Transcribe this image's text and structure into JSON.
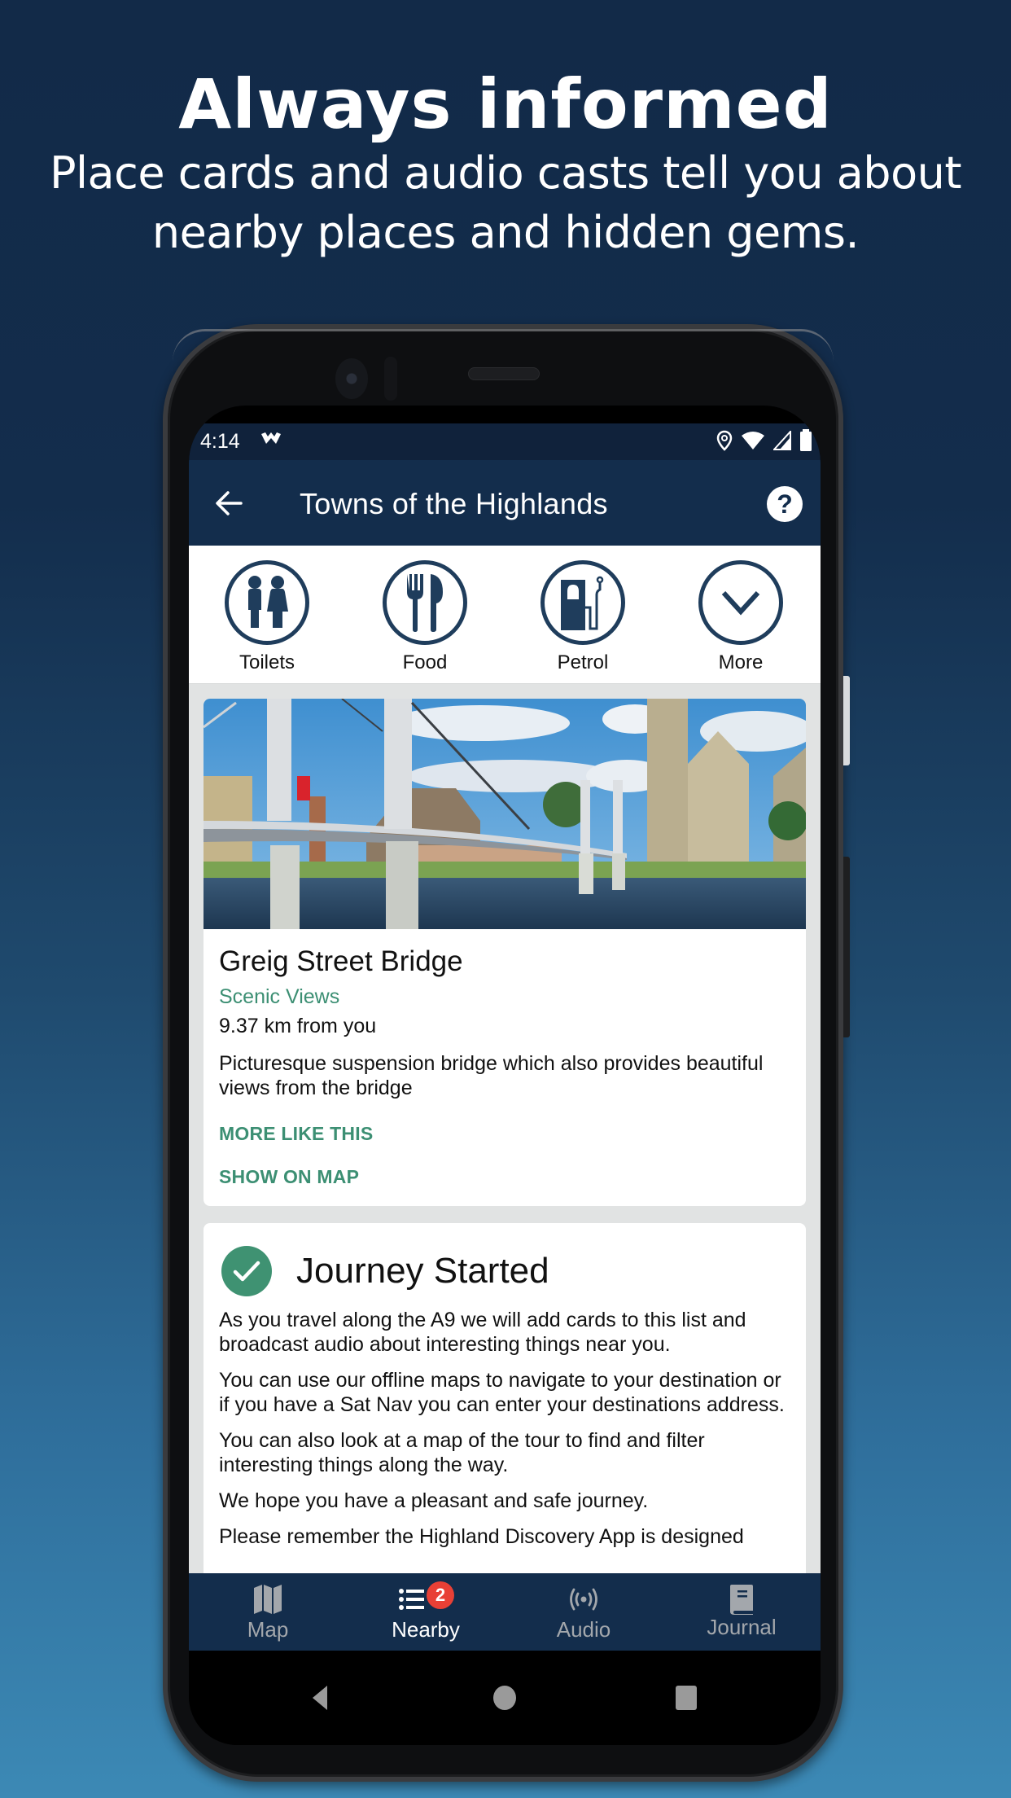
{
  "promo": {
    "title": "Always informed",
    "subtitle_line1": "Place cards and audio casts tell you about",
    "subtitle_line2": "nearby places and hidden gems."
  },
  "status_bar": {
    "time": "4:14",
    "icons": [
      "app-notification-icon",
      "location-icon",
      "wifi-icon",
      "signal-icon",
      "battery-icon"
    ]
  },
  "app_bar": {
    "back_icon": "arrow-left-icon",
    "title": "Towns of the Highlands",
    "help_label": "?"
  },
  "categories": [
    {
      "label": "Toilets",
      "icon": "toilets-icon"
    },
    {
      "label": "Food",
      "icon": "food-icon"
    },
    {
      "label": "Petrol",
      "icon": "petrol-icon"
    },
    {
      "label": "More",
      "icon": "chevron-down-icon"
    }
  ],
  "place_card": {
    "image_alt": "Greig Street Bridge over River Ness with church",
    "name": "Greig Street Bridge",
    "category": "Scenic Views",
    "distance": "9.37 km from you",
    "description": "Picturesque suspension bridge which also provides beautiful views from the bridge",
    "actions": {
      "more_like_this": "MORE LIKE THIS",
      "show_on_map": "SHOW ON MAP"
    }
  },
  "journey_card": {
    "title": "Journey Started",
    "paragraphs": [
      "As you travel along the A9 we will add cards to this list and broadcast audio about interesting things near you.",
      "You can use our offline maps to navigate to your destination or if you have a Sat Nav you can enter your destinations address.",
      "You can also look at a map of the tour to find and filter interesting things along the way.",
      "We hope you have a pleasant and safe journey.",
      "Please remember the Highland Discovery App is designed"
    ]
  },
  "bottom_nav": {
    "items": [
      {
        "label": "Map",
        "icon": "map-icon",
        "active": false
      },
      {
        "label": "Nearby",
        "icon": "list-icon",
        "active": true,
        "badge": "2"
      },
      {
        "label": "Audio",
        "icon": "broadcast-icon",
        "active": false
      },
      {
        "label": "Journal",
        "icon": "book-icon",
        "active": false
      }
    ]
  },
  "colors": {
    "primary_navy": "#132d4c",
    "accent_green": "#3c8f73",
    "badge_red": "#e84036",
    "content_bg": "#e1e3e3"
  }
}
